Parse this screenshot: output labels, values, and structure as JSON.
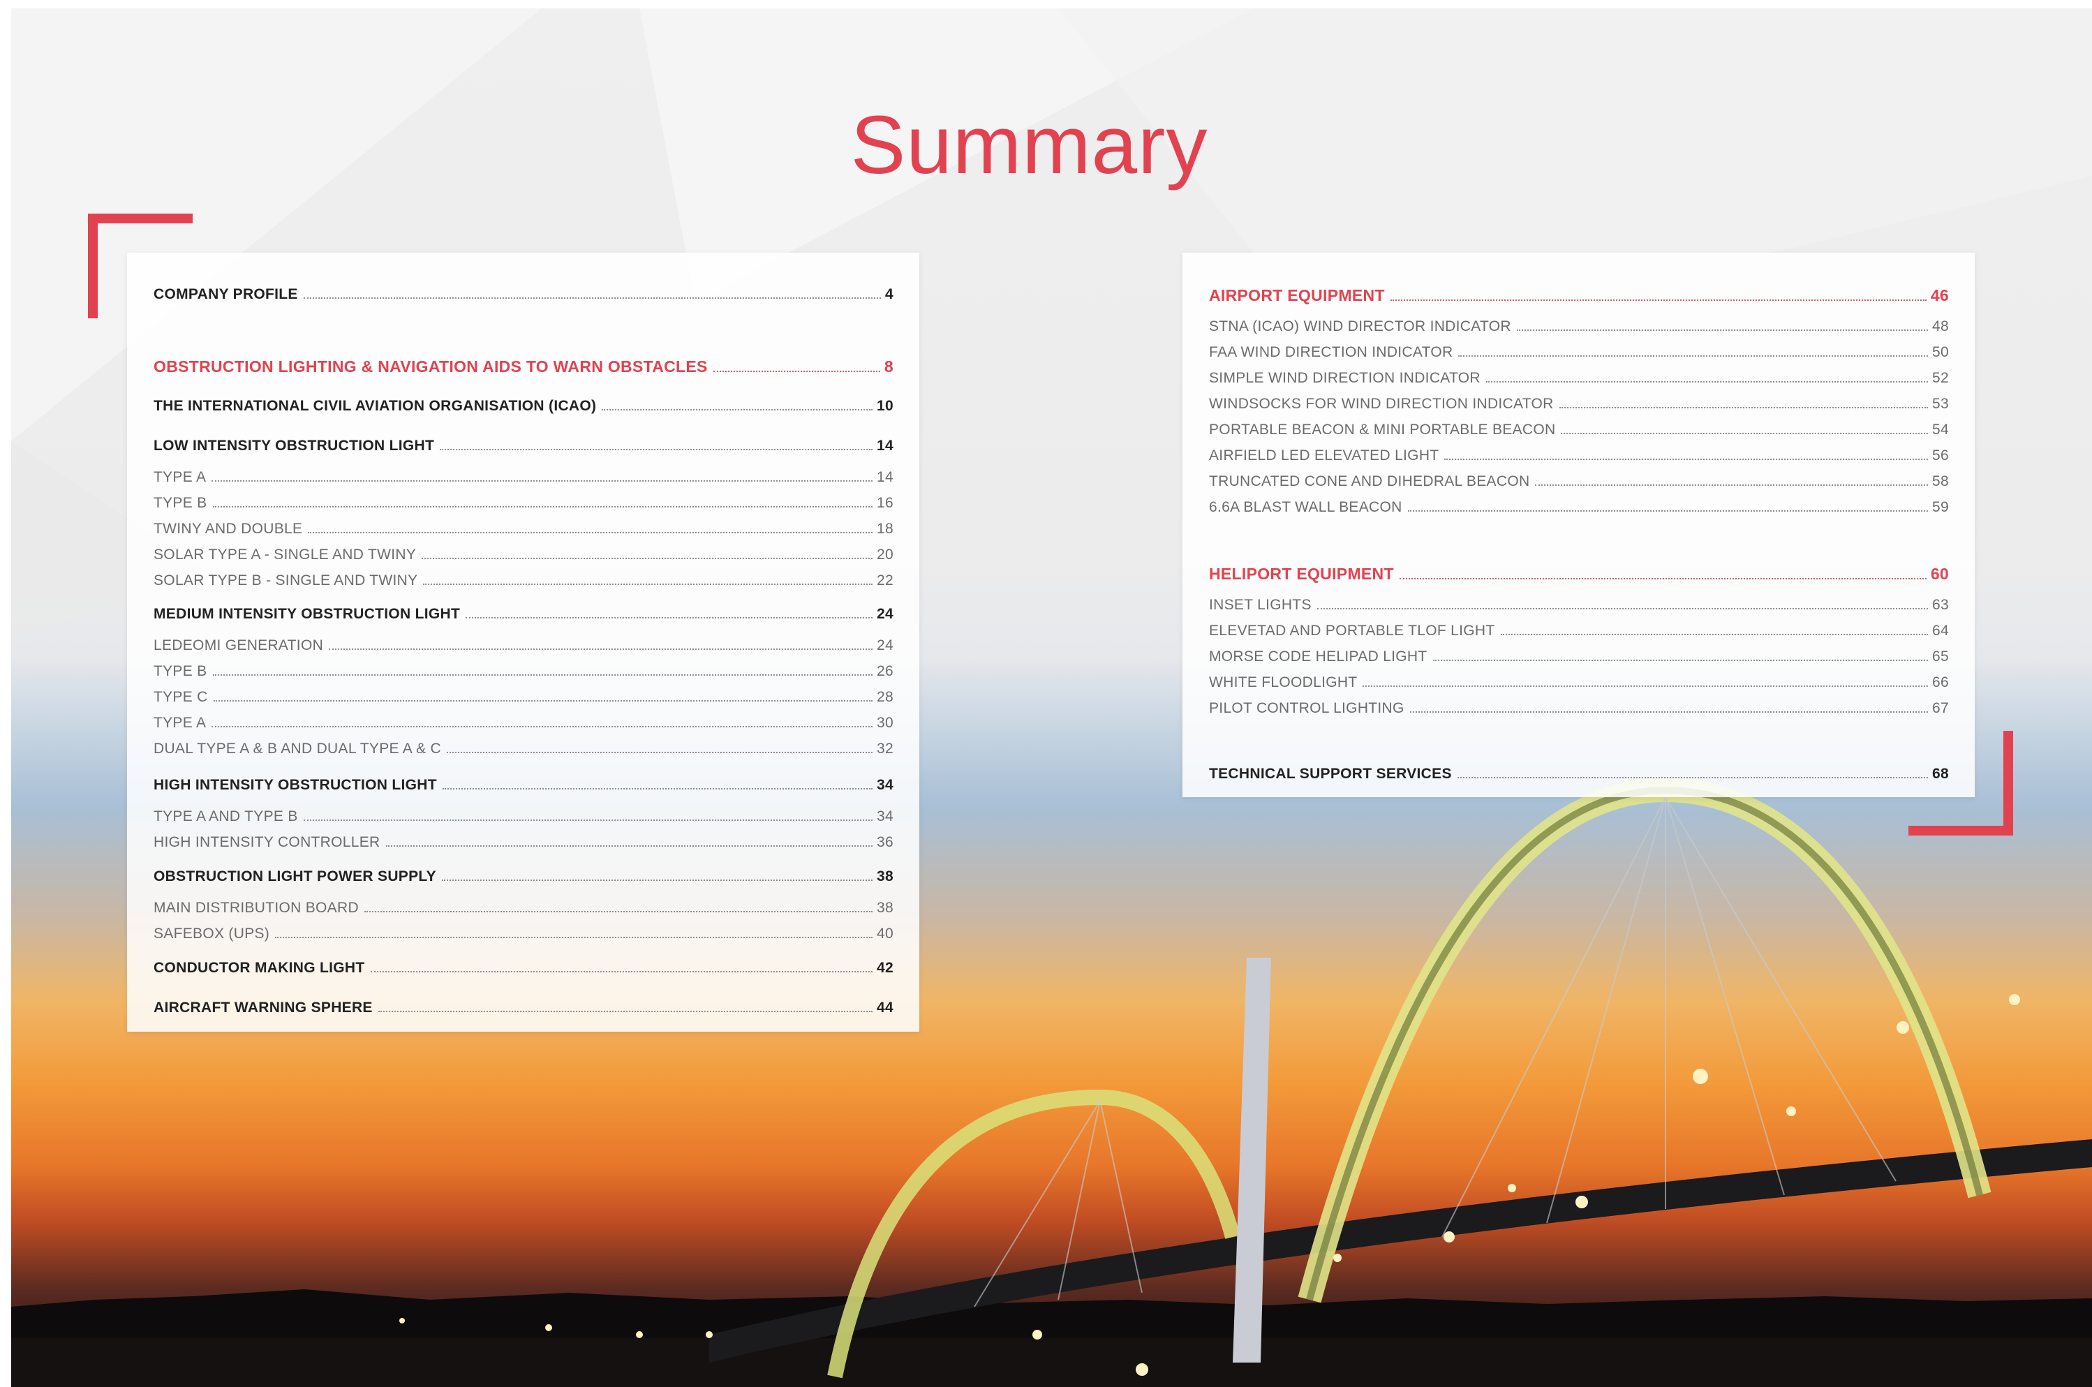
{
  "title": "Summary",
  "left_column": [
    {
      "label": "COMPANY PROFILE",
      "page": "4",
      "style": "bold"
    },
    {
      "label": "OBSTRUCTION LIGHTING & NAVIGATION AIDS TO WARN OBSTACLES",
      "page": "8",
      "style": "red"
    },
    {
      "label": "THE INTERNATIONAL CIVIL AVIATION ORGANISATION (ICAO)",
      "page": "10",
      "style": "bold"
    },
    {
      "label": "LOW INTENSITY OBSTRUCTION LIGHT",
      "page": "14",
      "style": "bold"
    },
    {
      "label": "TYPE A",
      "page": "14",
      "style": "normal"
    },
    {
      "label": "TYPE B",
      "page": "16",
      "style": "normal"
    },
    {
      "label": "TWINY AND DOUBLE",
      "page": "18",
      "style": "normal"
    },
    {
      "label": "SOLAR TYPE A - SINGLE AND TWINY",
      "page": "20",
      "style": "normal"
    },
    {
      "label": "SOLAR TYPE B - SINGLE AND TWINY",
      "page": "22",
      "style": "normal"
    },
    {
      "label": "MEDIUM INTENSITY OBSTRUCTION LIGHT",
      "page": "24",
      "style": "bold"
    },
    {
      "label": "LEDEOMI GENERATION",
      "page": "24",
      "style": "normal"
    },
    {
      "label": "TYPE B",
      "page": "26",
      "style": "normal"
    },
    {
      "label": "TYPE C",
      "page": "28",
      "style": "normal"
    },
    {
      "label": "TYPE A",
      "page": "30",
      "style": "normal"
    },
    {
      "label": "DUAL TYPE A & B AND DUAL TYPE A & C",
      "page": "32",
      "style": "normal"
    },
    {
      "label": "HIGH INTENSITY OBSTRUCTION LIGHT",
      "page": "34",
      "style": "bold"
    },
    {
      "label": "TYPE A AND TYPE B",
      "page": "34",
      "style": "normal"
    },
    {
      "label": "HIGH INTENSITY CONTROLLER",
      "page": "36",
      "style": "normal"
    },
    {
      "label": "OBSTRUCTION LIGHT POWER SUPPLY",
      "page": "38",
      "style": "bold"
    },
    {
      "label": "MAIN DISTRIBUTION BOARD",
      "page": "38",
      "style": "normal"
    },
    {
      "label": "SAFEBOX (UPS)",
      "page": "40",
      "style": "normal"
    },
    {
      "label": "CONDUCTOR MAKING LIGHT",
      "page": "42",
      "style": "bold"
    },
    {
      "label": "AIRCRAFT WARNING SPHERE",
      "page": "44",
      "style": "bold"
    }
  ],
  "right_column": [
    {
      "label": "AIRPORT EQUIPMENT",
      "page": "46",
      "style": "red"
    },
    {
      "label": "STNA (ICAO) WIND DIRECTOR INDICATOR",
      "page": "48",
      "style": "normal"
    },
    {
      "label": "FAA WIND DIRECTION INDICATOR",
      "page": "50",
      "style": "normal"
    },
    {
      "label": "SIMPLE WIND DIRECTION INDICATOR",
      "page": "52",
      "style": "normal"
    },
    {
      "label": "WINDSOCKS FOR WIND DIRECTION INDICATOR",
      "page": "53",
      "style": "normal"
    },
    {
      "label": "PORTABLE BEACON & MINI PORTABLE BEACON",
      "page": "54",
      "style": "normal"
    },
    {
      "label": "AIRFIELD LED ELEVATED LIGHT",
      "page": "56",
      "style": "normal"
    },
    {
      "label": "TRUNCATED CONE AND DIHEDRAL BEACON",
      "page": "58",
      "style": "normal"
    },
    {
      "label": "6.6A BLAST WALL BEACON",
      "page": "59",
      "style": "normal"
    },
    {
      "label": "HELIPORT EQUIPMENT",
      "page": "60",
      "style": "red"
    },
    {
      "label": "INSET LIGHTS",
      "page": "63",
      "style": "normal"
    },
    {
      "label": "ELEVETAD AND PORTABLE TLOF LIGHT",
      "page": "64",
      "style": "normal"
    },
    {
      "label": "MORSE CODE HELIPAD LIGHT",
      "page": "65",
      "style": "normal"
    },
    {
      "label": "WHITE FLOODLIGHT",
      "page": "66",
      "style": "normal"
    },
    {
      "label": "PILOT CONTROL LIGHTING",
      "page": "67",
      "style": "normal"
    },
    {
      "label": "TECHNICAL SUPPORT SERVICES",
      "page": "68",
      "style": "bold"
    }
  ],
  "colors": {
    "accent": "#e2424f",
    "text_bold": "#222222",
    "text_normal": "#6b6b6b"
  }
}
